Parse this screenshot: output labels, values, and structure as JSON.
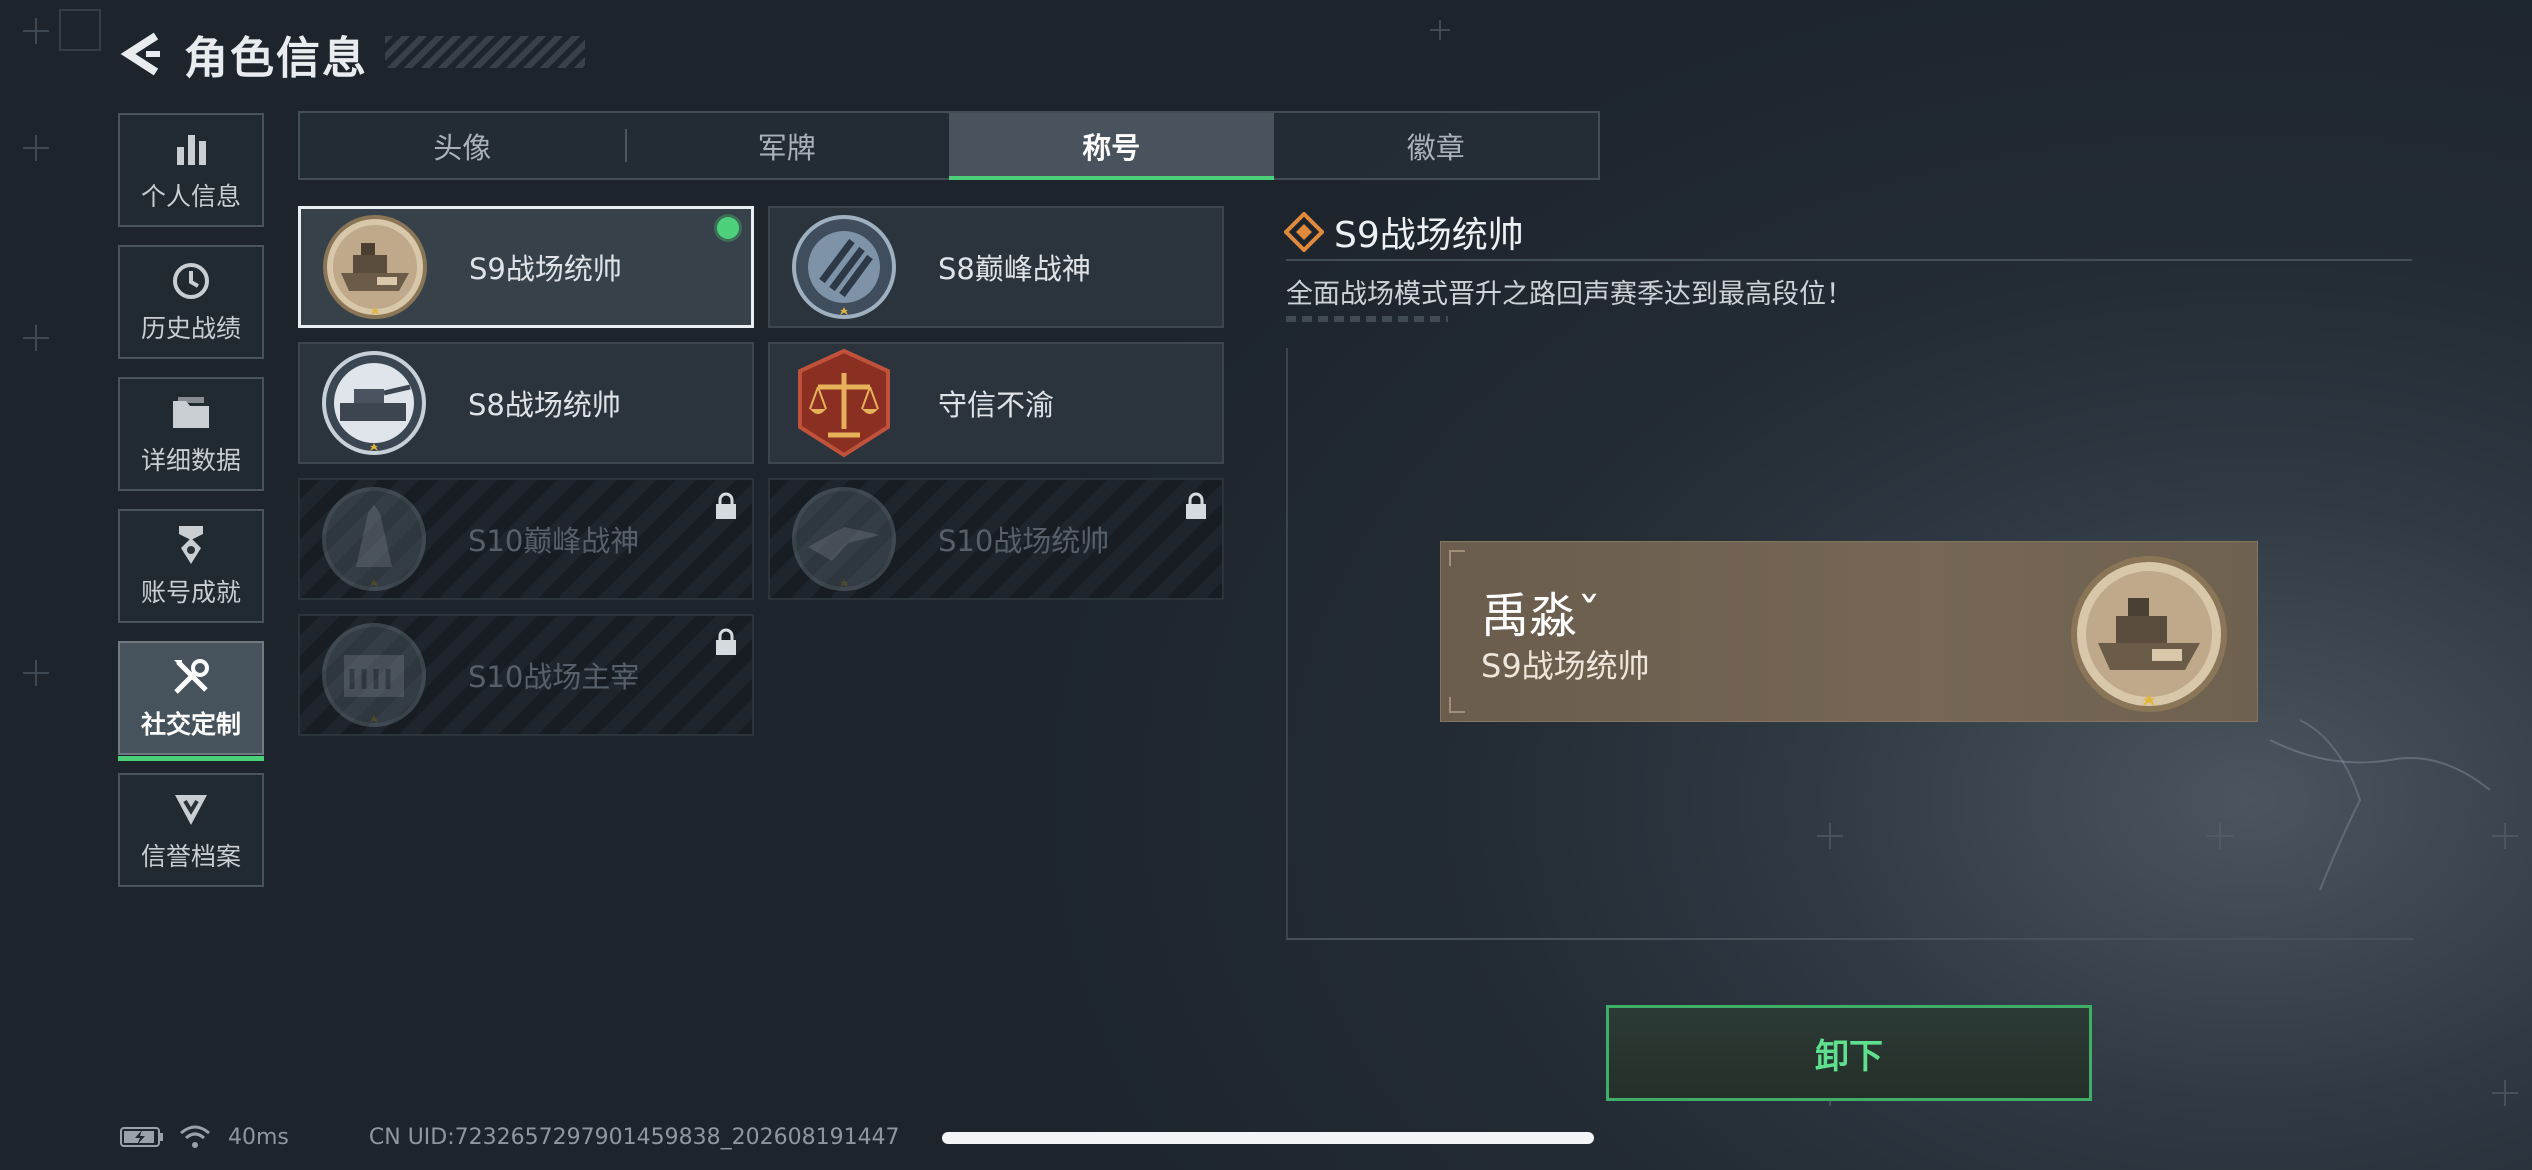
{
  "header": {
    "title": "角色信息"
  },
  "sidebar": {
    "items": [
      {
        "label": "个人信息",
        "icon": "bar-chart-icon"
      },
      {
        "label": "历史战绩",
        "icon": "history-clock-icon"
      },
      {
        "label": "详细数据",
        "icon": "folder-icon"
      },
      {
        "label": "账号成就",
        "icon": "achievement-badge-icon"
      },
      {
        "label": "社交定制",
        "icon": "tools-icon",
        "active": true
      },
      {
        "label": "信誉档案",
        "icon": "credit-shield-icon"
      }
    ]
  },
  "tabs": [
    {
      "label": "头像"
    },
    {
      "label": "军牌"
    },
    {
      "label": "称号",
      "active": true
    },
    {
      "label": "徽章"
    }
  ],
  "titles": [
    {
      "name": "S9战场统帅",
      "emblem": "ship-emblem",
      "selected": true,
      "equipped": true
    },
    {
      "name": "S8巅峰战神",
      "emblem": "striped-emblem"
    },
    {
      "name": "S8战场统帅",
      "emblem": "tank-emblem"
    },
    {
      "name": "守信不渝",
      "emblem": "scales-emblem"
    },
    {
      "name": "S10巅峰战神",
      "emblem": "tower-emblem",
      "locked": true
    },
    {
      "name": "S10战场统帅",
      "emblem": "jet-emblem",
      "locked": true
    },
    {
      "name": "S10战场主宰",
      "emblem": "colosseum-emblem",
      "locked": true
    }
  ],
  "detail": {
    "title": "S9战场统帅",
    "description": "全面战场模式晋升之路回声赛季达到最高段位！"
  },
  "preview": {
    "player_name": "禹淼ˇ",
    "title": "S9战场统帅"
  },
  "actions": {
    "unequip_label": "卸下"
  },
  "status": {
    "ping": "40ms",
    "uid": "CN UID:7232657297901459838_202608191447"
  },
  "colors": {
    "accent": "#4cd07a",
    "preview_bg": "#6f6150"
  }
}
